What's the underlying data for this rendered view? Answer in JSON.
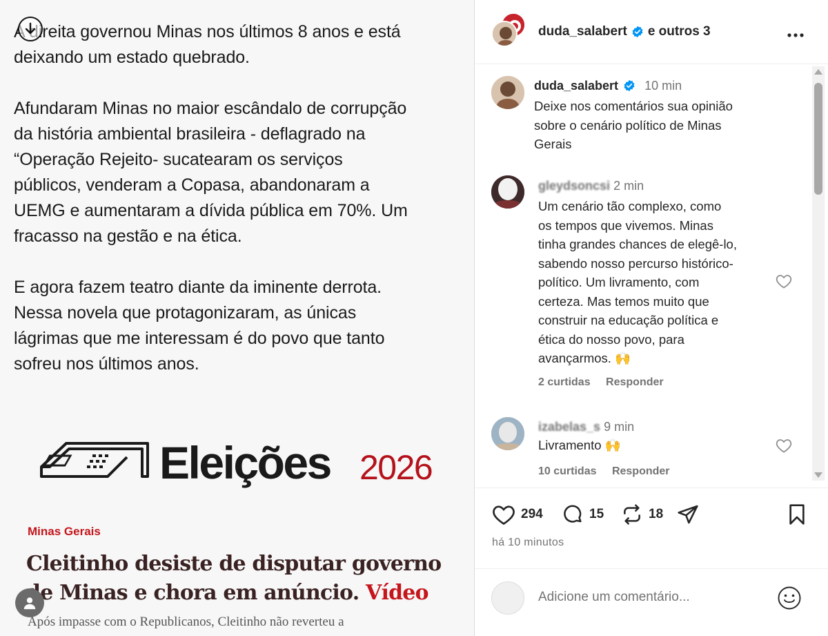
{
  "post_media": {
    "tweet_text": "A direita governou Minas nos últimos 8 anos  e está\ndeixando um estado quebrado.\n\nAfundaram Minas no maior escândalo de corrupção\nda história ambiental brasileira - deflagrado na\n“Operação Rejeito- sucatearam os serviços\npúblicos, venderam a Copasa, abandonaram a\nUEMG e aumentaram a dívida pública em 70%. Um\nfracasso na gestão e na ética.\n\nE agora fazem teatro diante da iminente derrota.\nNessa novela que protagonizaram, as únicas\nlágrimas que me interessam é do povo que tanto\nsofreu nos últimos anos.",
    "logo_word": "Eleições",
    "logo_year": "2026",
    "news_kicker": "Minas Gerais",
    "news_headline_main": "Cleitinho desiste de disputar governo de Minas e chora em anúncio.",
    "news_headline_tag": "Vídeo",
    "news_lede": "Após impasse com o Republicanos, Cleitinho não reverteu a"
  },
  "header": {
    "username": "duda_salabert",
    "others": "e outros 3",
    "more_icon": "more-horizontal-icon"
  },
  "caption": {
    "username": "duda_salabert",
    "time": "10 min",
    "text": "Deixe nos comentários sua opinião\nsobre o cenário político de Minas\nGerais"
  },
  "comments": [
    {
      "username": "gleydsoncsi",
      "time": "2 min",
      "text": "Um cenário tão complexo, como\nos tempos que vivemos. Minas\ntinha grandes chances de elegê-lo,\nsabendo nosso percurso histórico-\npolítico. Um livramento, com\ncerteza. Mas temos muito que\nconstruir na educação política e\nética do nosso povo, para\navançarmos. 🙌",
      "likes": "2 curtidas",
      "reply": "Responder"
    },
    {
      "username": "izabelas_s",
      "time": "9 min",
      "text": "Livramento 🙌",
      "likes": "10 curtidas",
      "reply": "Responder"
    }
  ],
  "actions": {
    "like_count": "294",
    "comment_count": "15",
    "repost_count": "18",
    "posted_ago": "há 10 minutos"
  },
  "add_comment": {
    "placeholder": "Adicione um comentário..."
  },
  "colors": {
    "verified": "#0095f6",
    "brand_red": "#c4161c",
    "muted": "#737373"
  }
}
